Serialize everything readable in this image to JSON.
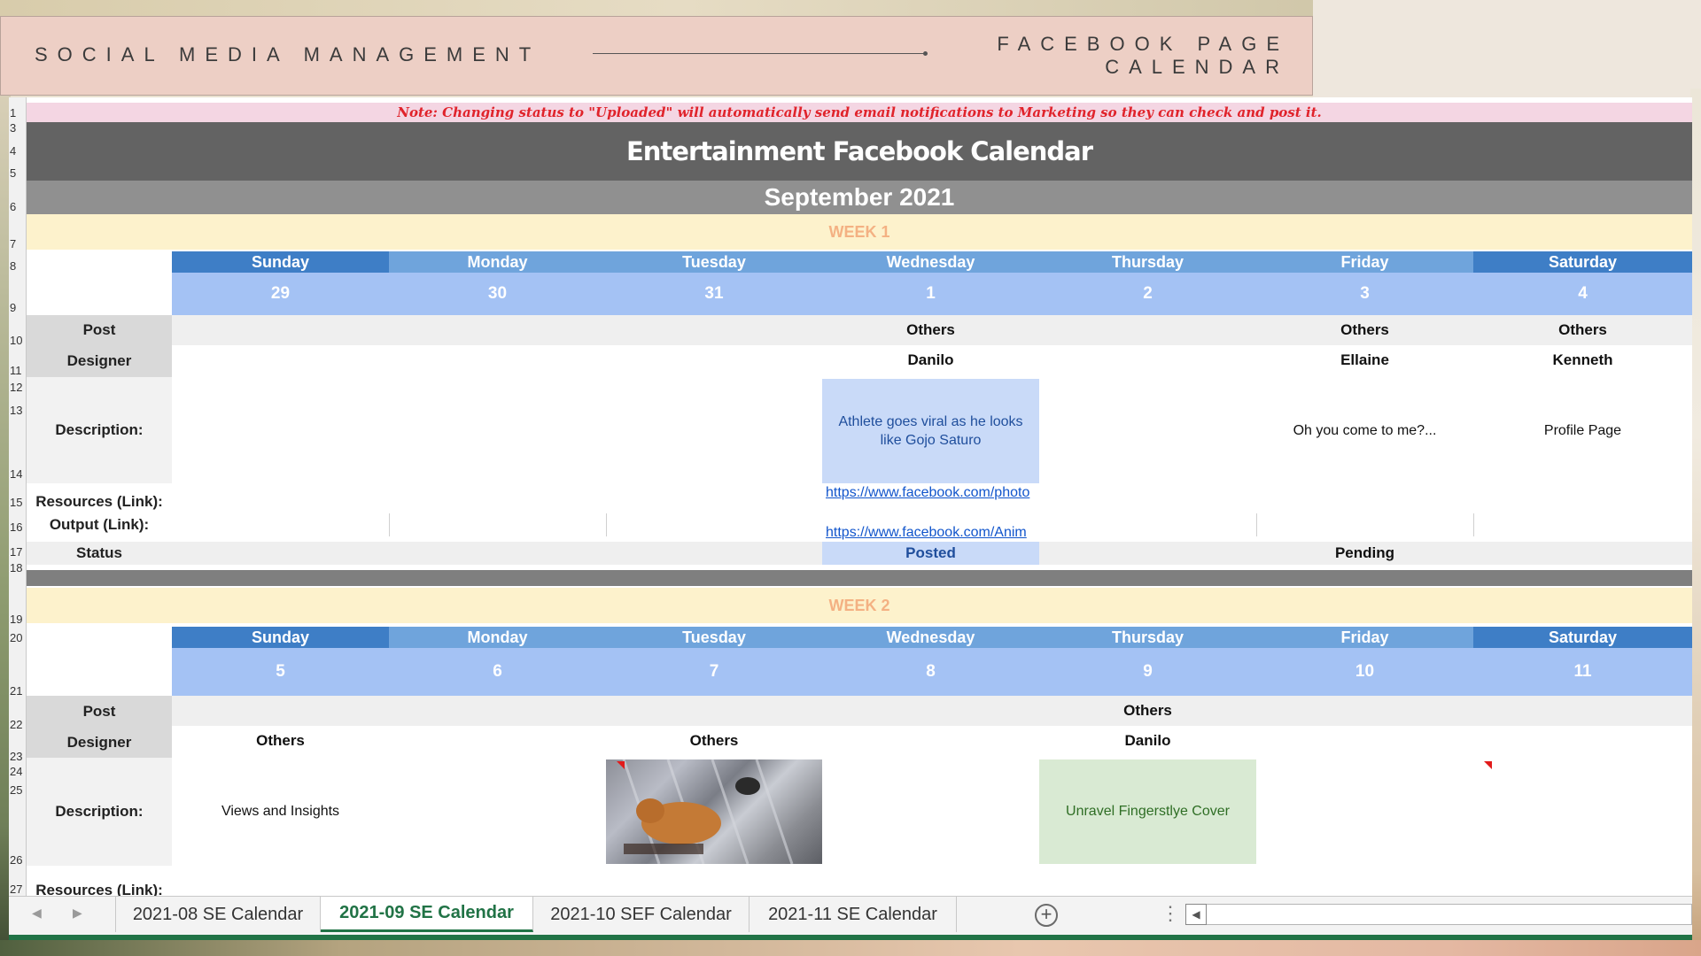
{
  "banner": {
    "left_title": "SOCIAL MEDIA MANAGEMENT",
    "right_title_line1": "FACEBOOK PAGE",
    "right_title_line2": "CALENDAR"
  },
  "sheet": {
    "note": "Note: Changing status to \"Uploaded\" will automatically send email notifications to Marketing so they can check and post it.",
    "title": "Entertainment Facebook Calendar",
    "month": "September 2021",
    "row_labels": {
      "post": "Post",
      "designer": "Designer",
      "description": "Description:",
      "resources": "Resources (Link):",
      "output": "Output (Link):",
      "status": "Status"
    },
    "row_numbers": [
      "1",
      "3",
      "4",
      "5",
      "6",
      "7",
      "8",
      "9",
      "10",
      "11",
      "12",
      "13",
      "14",
      "15",
      "16",
      "17",
      "18",
      "19",
      "20",
      "21",
      "22",
      "23",
      "24",
      "25",
      "26",
      "27"
    ],
    "day_names": [
      "Sunday",
      "Monday",
      "Tuesday",
      "Wednesday",
      "Thursday",
      "Friday",
      "Saturday"
    ],
    "week1": {
      "label": "WEEK 1",
      "dates": [
        "29",
        "30",
        "31",
        "1",
        "2",
        "3",
        "4"
      ],
      "wed": {
        "post": "Others",
        "designer": "Danilo",
        "description": "Athlete goes viral as he looks like Gojo Saturo",
        "resource_link": "https://www.facebook.com/photo",
        "output_link": "https://www.facebook.com/Anim",
        "status": "Posted"
      },
      "fri": {
        "post": "Others",
        "designer": "Ellaine",
        "description": "Oh you come to me?...",
        "status": "Pending"
      },
      "sat": {
        "post": "Others",
        "designer": "Kenneth",
        "description": "Profile Page"
      }
    },
    "week2": {
      "label": "WEEK 2",
      "dates": [
        "5",
        "6",
        "7",
        "8",
        "9",
        "10",
        "11"
      ],
      "sun": {
        "designer": "Others",
        "description": "Views and Insights"
      },
      "tue": {
        "designer": "Others"
      },
      "thu": {
        "post": "Others",
        "designer": "Danilo",
        "description": "Unravel Fingerstlye Cover"
      }
    },
    "truncated_label": "Resources (Link):"
  },
  "tabs": {
    "items": [
      "2021-08 SE Calendar",
      "2021-09 SE Calendar",
      "2021-10 SEF Calendar",
      "2021-11 SE Calendar"
    ],
    "active": "2021-09 SE Calendar"
  },
  "icons": {
    "prev_sheet": "chevron-left-icon",
    "next_sheet": "chevron-right-icon",
    "add_sheet": "plus-circle-icon",
    "more": "kebab-icon",
    "scroll_left": "scroll-left-icon"
  },
  "colors": {
    "banner": "#edcfc5",
    "title_bg": "#636363",
    "month_bg": "#909090",
    "week_bg": "#fdf2cc",
    "week_text": "#f4b183",
    "day_dark": "#3e7ec6",
    "day_light": "#6fa4dc",
    "date_bg": "#a4c2f4",
    "note_text": "#e0232b",
    "active_tab": "#217346"
  }
}
